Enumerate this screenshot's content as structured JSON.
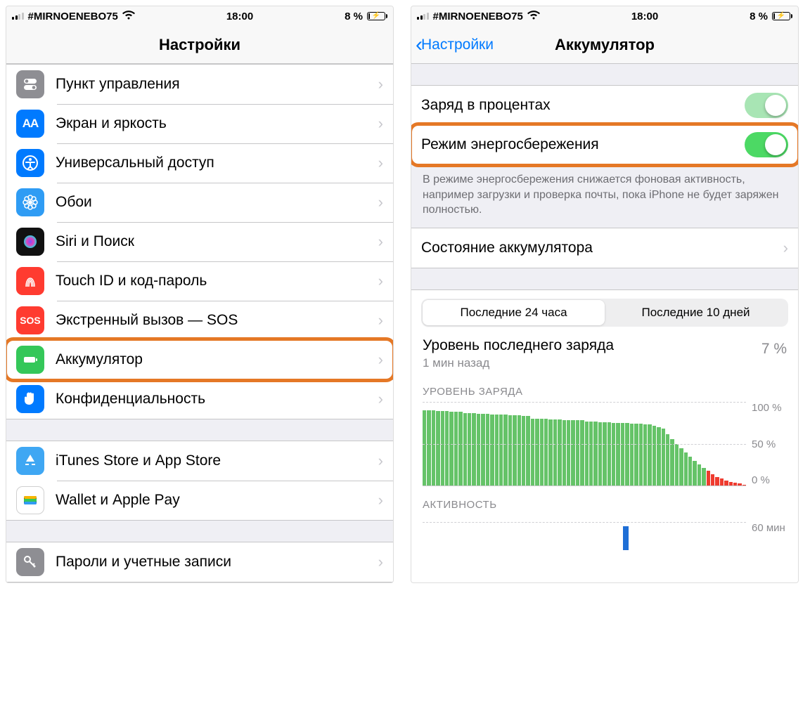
{
  "status": {
    "carrier": "#MIRNOENEBO75",
    "time": "18:00",
    "battery_text": "8 %"
  },
  "left": {
    "title": "Настройки",
    "items": [
      {
        "label": "Пункт управления",
        "icon": "toggle",
        "bg": "bg-gray"
      },
      {
        "label": "Экран и яркость",
        "icon": "aa",
        "bg": "bg-blue"
      },
      {
        "label": "Универсальный доступ",
        "icon": "access",
        "bg": "bg-blue"
      },
      {
        "label": "Обои",
        "icon": "flower",
        "bg": "bg-lightblue"
      },
      {
        "label": "Siri и Поиск",
        "icon": "siri",
        "bg": "bg-black"
      },
      {
        "label": "Touch ID и код-пароль",
        "icon": "finger",
        "bg": "bg-red"
      },
      {
        "label": "Экстренный вызов — SOS",
        "icon": "sos",
        "bg": "bg-sos"
      },
      {
        "label": "Аккумулятор",
        "icon": "battery",
        "bg": "bg-green",
        "highlight": true
      },
      {
        "label": "Конфиденциальность",
        "icon": "hand",
        "bg": "bg-blue"
      }
    ],
    "group2": [
      {
        "label": "iTunes Store и App Store",
        "icon": "appstore",
        "bg": "bg-itunes"
      },
      {
        "label": "Wallet и Apple Pay",
        "icon": "wallet",
        "bg": "bg-wallet"
      }
    ],
    "group3": [
      {
        "label": "Пароли и учетные записи",
        "icon": "key",
        "bg": "bg-key"
      }
    ]
  },
  "right": {
    "back": "Настройки",
    "title": "Аккумулятор",
    "rows": {
      "percent_label": "Заряд в процентах",
      "lowpower_label": "Режим энергосбережения",
      "note": "В режиме энергосбережения снижается фоновая активность, например загрузки и проверка почты, пока iPhone не будет заряжен полностью.",
      "health_label": "Состояние аккумулятора"
    },
    "segments": {
      "a": "Последние 24 часа",
      "b": "Последние 10 дней"
    },
    "summary": {
      "title": "Уровень последнего заряда",
      "sub": "1 мин назад",
      "value": "7 %"
    },
    "chart": {
      "title": "УРОВЕНЬ ЗАРЯДА",
      "y_top": "100 %",
      "y_mid": "50 %",
      "y_bot": "0 %"
    },
    "activity": {
      "title": "АКТИВНОСТЬ",
      "y": "60 мин"
    }
  },
  "chart_data": {
    "type": "bar",
    "title": "УРОВЕНЬ ЗАРЯДА",
    "ylabel": "%",
    "ylim": [
      0,
      100
    ],
    "categories_note": "hourly over last 24h",
    "values": [
      90,
      90,
      90,
      89,
      89,
      89,
      88,
      88,
      88,
      87,
      87,
      87,
      86,
      86,
      86,
      85,
      85,
      85,
      85,
      84,
      84,
      84,
      83,
      83,
      80,
      80,
      80,
      80,
      79,
      79,
      79,
      78,
      78,
      78,
      78,
      78,
      77,
      77,
      77,
      76,
      76,
      76,
      75,
      75,
      75,
      75,
      74,
      74,
      74,
      73,
      73,
      72,
      70,
      68,
      62,
      56,
      50,
      45,
      40,
      35,
      30,
      26,
      22,
      18,
      14,
      11,
      9,
      7,
      5,
      4,
      3,
      2
    ],
    "low_power_threshold": 20,
    "series": [
      {
        "name": "charge_level",
        "color": "#65c368",
        "low_color": "#ef3b2f"
      }
    ]
  }
}
